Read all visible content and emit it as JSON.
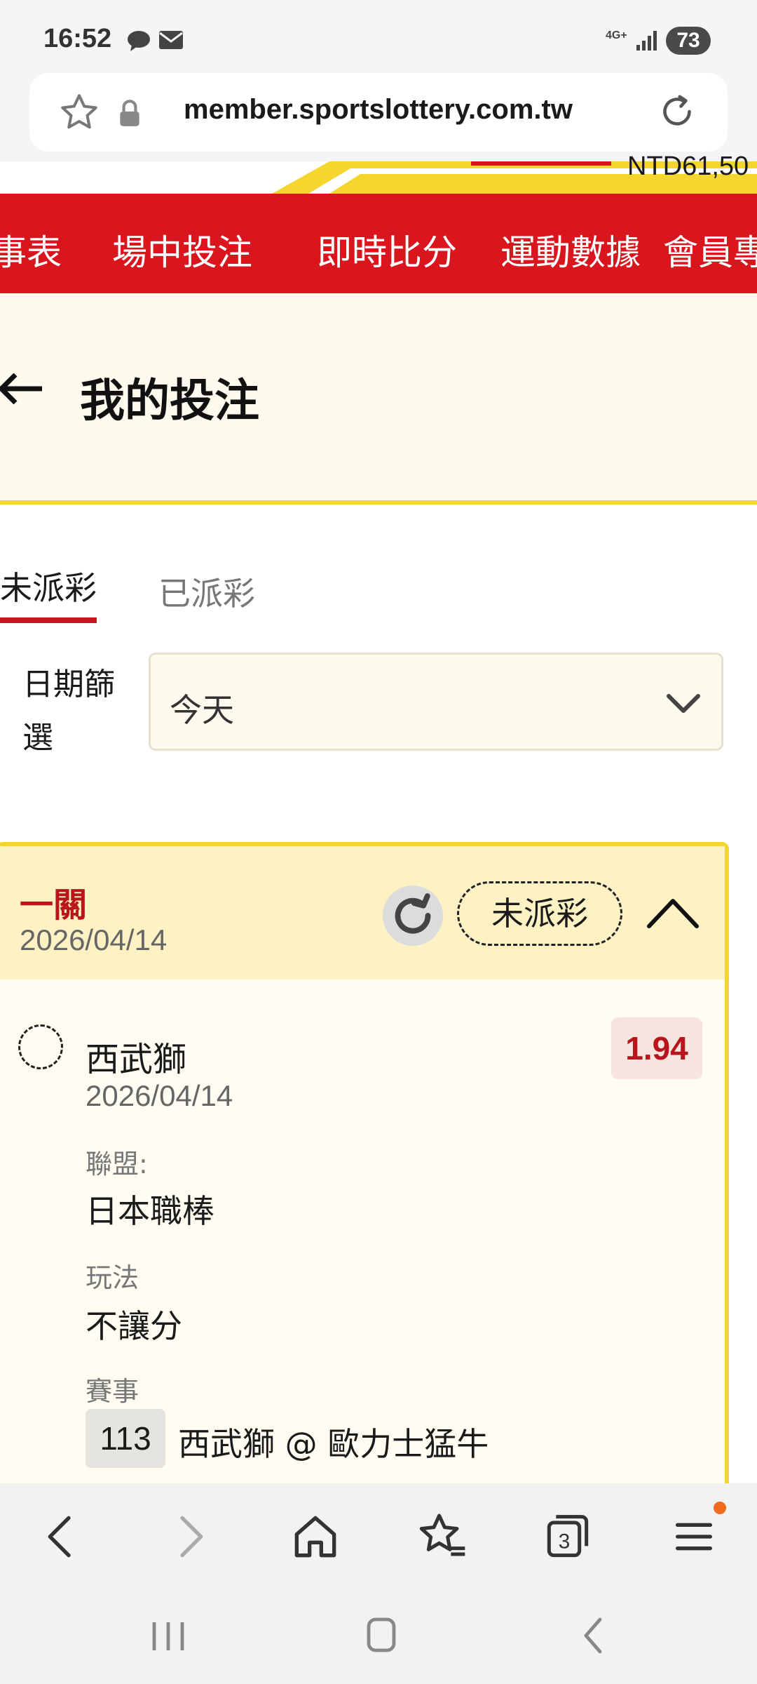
{
  "status_bar": {
    "time": "16:52",
    "battery": "73",
    "network": "4G+"
  },
  "browser": {
    "url": "member.sportslottery.com.tw"
  },
  "site": {
    "balance": "NTD61,50",
    "nav_items": [
      "事表",
      "場中投注",
      "即時比分",
      "運動數據",
      "會員專"
    ]
  },
  "page": {
    "title": "我的投注",
    "tabs": {
      "unpaid": "未派彩",
      "paid": "已派彩"
    },
    "filter": {
      "label": "日期篩選",
      "value": "今天"
    }
  },
  "bet_card": {
    "type": "一關",
    "date": "2026/04/14",
    "status": "未派彩",
    "selection": {
      "team": "西武獅",
      "date": "2026/04/14",
      "odds": "1.94",
      "league_label": "聯盟:",
      "league": "日本職棒",
      "play_label": "玩法",
      "play": "不讓分",
      "event_label": "賽事",
      "event_number": "113",
      "event": "西武獅 @ 歐力士猛牛"
    }
  },
  "colors": {
    "brand_red": "#d9161e",
    "accent_yellow": "#f5d62f",
    "cream": "#fefaed"
  }
}
